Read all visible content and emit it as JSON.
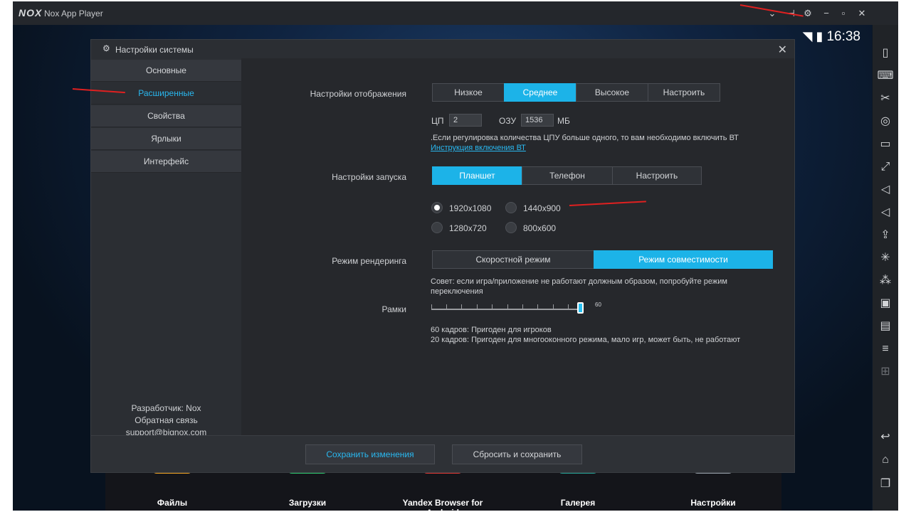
{
  "window": {
    "logo": "NOX",
    "title": "Nox App Player",
    "controls": [
      "chevron-down",
      "pin",
      "settings",
      "minimize",
      "maximize",
      "close"
    ]
  },
  "statusbar": {
    "time": "16:38"
  },
  "dialog": {
    "title": "Настройки системы",
    "nav": [
      "Основные",
      "Расширенные",
      "Свойства",
      "Ярлыки",
      "Интерфейс"
    ],
    "active_nav": "Расширенные",
    "credits": {
      "developer": "Разработчик: Nox",
      "feedback": "Обратная связь",
      "email": "support@bignox.com"
    },
    "display": {
      "label": "Настройки отображения",
      "options": [
        "Низкое",
        "Среднее",
        "Высокое",
        "Настроить"
      ],
      "selected": "Среднее",
      "cpu_label": "ЦП",
      "cpu_value": "2",
      "ram_label": "ОЗУ",
      "ram_value": "1536",
      "ram_unit": "МБ",
      "note": ".Если регулировка количества ЦПУ больше одного, то вам необходимо включить ВТ",
      "link": "Инструкция включения ВТ"
    },
    "startup": {
      "label": "Настройки запуска",
      "options": [
        "Планшет",
        "Телефон",
        "Настроить"
      ],
      "selected": "Планшет",
      "resolutions": [
        "1920x1080",
        "1440x900",
        "1280x720",
        "800x600"
      ],
      "selected_resolution": "1920x1080"
    },
    "render": {
      "label": "Режим рендеринга",
      "options": [
        "Скоростной режим",
        "Режим совместимости"
      ],
      "selected": "Режим совместимости",
      "tip": "Совет: если игра/приложение не работают должным образом, попробуйте режим переключения"
    },
    "frames": {
      "label": "Рамки",
      "value": "60",
      "slider_fraction": 1.0,
      "note1": "60 кадров: Пригоден для игроков",
      "note2": "20 кадров: Пригоден для многооконного режима, мало игр, может быть, не работают"
    },
    "buttons": {
      "save": "Сохранить изменения",
      "reset": "Сбросить и сохранить"
    }
  },
  "dock": [
    {
      "label": "Файлы",
      "color": "#f5a623"
    },
    {
      "label": "Загрузки",
      "color": "#2ecc71"
    },
    {
      "label": "Yandex Browser for Android",
      "color": "#e53935"
    },
    {
      "label": "Галерея",
      "color": "#26a69a"
    },
    {
      "label": "Настройки",
      "color": "#9aa3ad"
    }
  ],
  "sidebar_icons": [
    "phone-icon",
    "keyboard-icon",
    "scissors-icon",
    "location-icon",
    "screen-icon",
    "fullscreen-icon",
    "volume-up-icon",
    "volume-down-icon",
    "install-apk-icon",
    "shake-icon",
    "macro-icon",
    "record-icon",
    "multi-instance-icon",
    "menu-icon",
    "screenshot-icon",
    "back-icon",
    "home-icon",
    "recent-apps-icon"
  ],
  "colors": {
    "accent": "#1cb3e8",
    "arrow": "#e02020"
  }
}
